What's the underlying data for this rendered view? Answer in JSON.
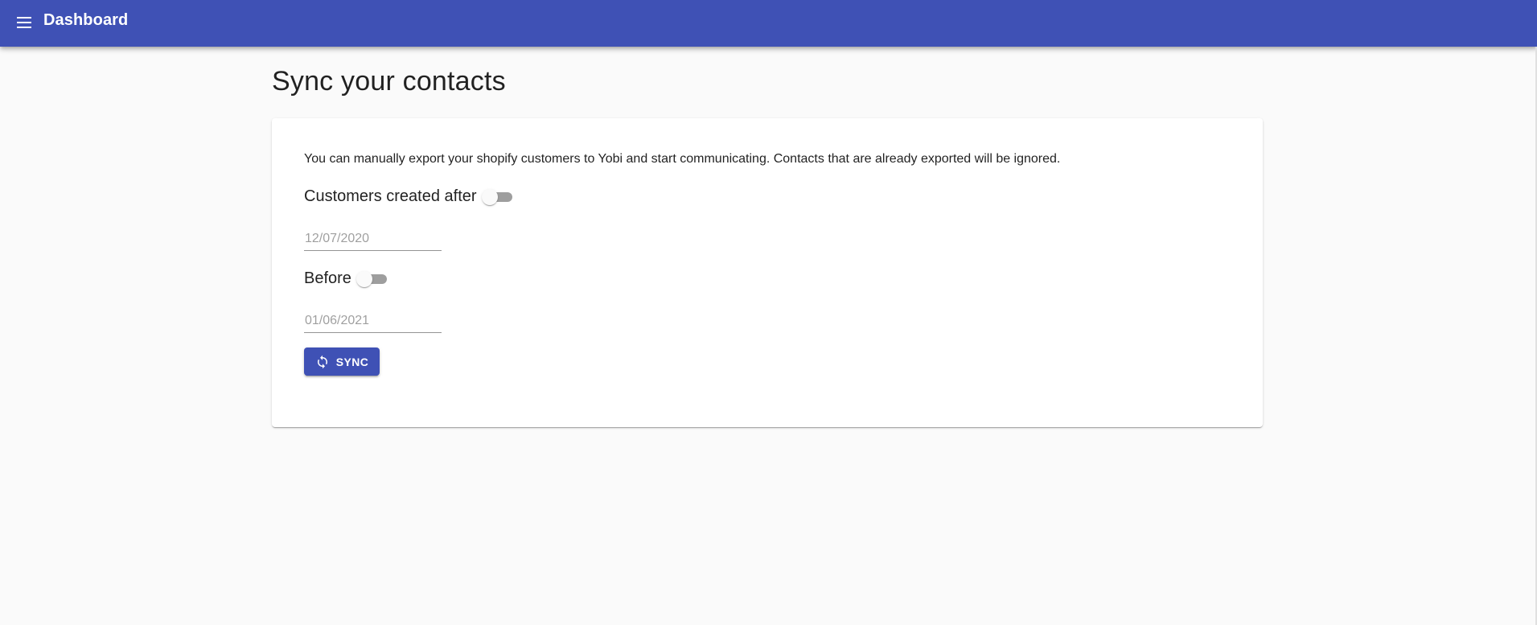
{
  "appbar": {
    "title": "Dashboard",
    "menu_icon": "menu-icon",
    "color": "#3f51b5"
  },
  "page": {
    "title": "Sync your contacts"
  },
  "card": {
    "intro": "You can manually export your shopify customers to Yobi and start communicating. Contacts that are already exported will be ignored.",
    "after": {
      "label": "Customers created after",
      "toggle_on": false,
      "date_value": "12/07/2020"
    },
    "before": {
      "label": "Before",
      "toggle_on": false,
      "date_value": "01/06/2021"
    },
    "sync_button": {
      "label": "SYNC",
      "icon": "sync-icon"
    }
  }
}
